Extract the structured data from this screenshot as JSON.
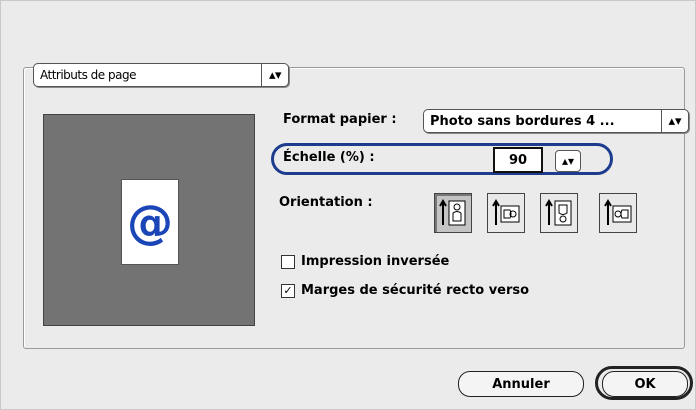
{
  "section_selector": {
    "selected": "Attributs de page",
    "icon": "up-down-arrows-icon"
  },
  "paper": {
    "label": "Format papier :",
    "selected": "Photo sans bordures 4 ..."
  },
  "scale": {
    "label": "Échelle (%) :",
    "value": "90"
  },
  "orientation": {
    "label": "Orientation :",
    "options": [
      {
        "name": "portrait",
        "selected": true
      },
      {
        "name": "landscape-left",
        "selected": false
      },
      {
        "name": "portrait-reversed",
        "selected": false
      },
      {
        "name": "landscape-right",
        "selected": false
      }
    ]
  },
  "options": {
    "reverse_printing": {
      "label": "Impression inversée",
      "checked": false
    },
    "duplex_margins": {
      "label": "Marges de sécurité recto verso",
      "checked": true
    }
  },
  "preview": {
    "symbol": "@"
  },
  "buttons": {
    "cancel": "Annuler",
    "ok": "OK"
  },
  "colors": {
    "highlight": "#1d3c8e",
    "preview_bg": "#737373",
    "preview_symbol": "#1a46b8"
  }
}
